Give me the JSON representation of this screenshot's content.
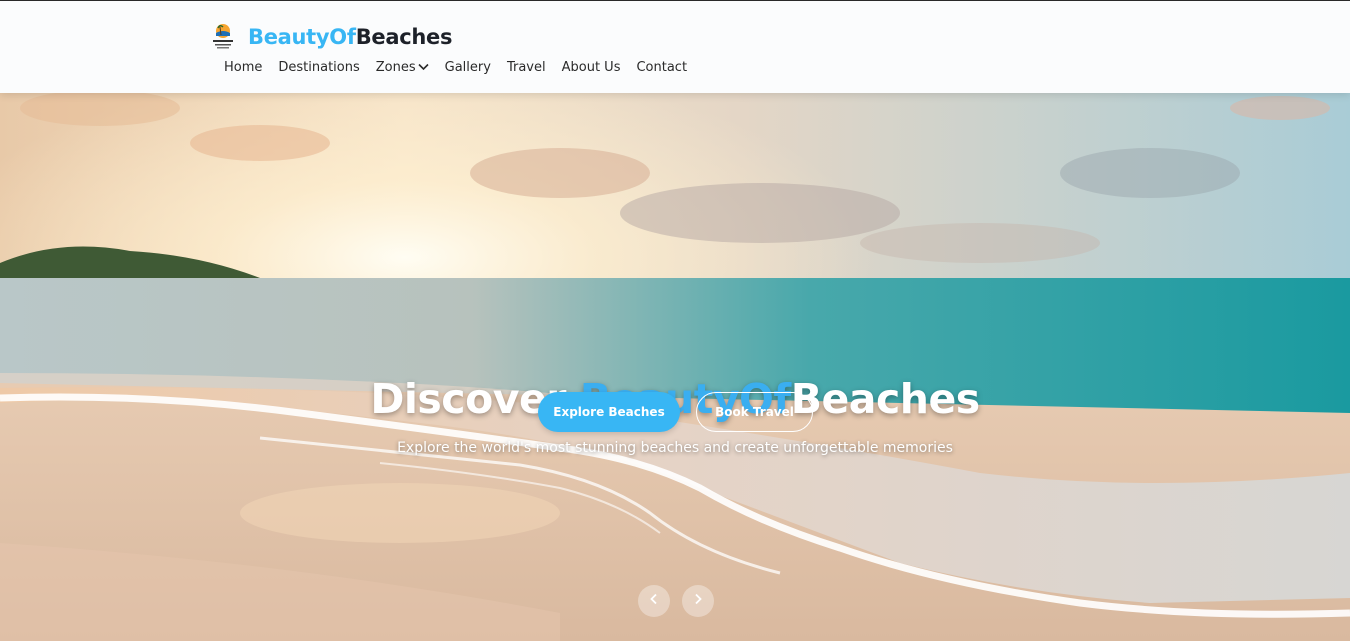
{
  "brand": {
    "name_part1": "BeautyOf",
    "name_part2": "Beaches",
    "logo_text": "BEAUTY OF BEACHES"
  },
  "nav": {
    "items": [
      {
        "label": "Home"
      },
      {
        "label": "Destinations"
      },
      {
        "label": "Zones",
        "has_dropdown": true
      },
      {
        "label": "Gallery"
      },
      {
        "label": "Travel"
      },
      {
        "label": "About Us"
      },
      {
        "label": "Contact"
      }
    ]
  },
  "hero": {
    "title_prefix": "Discover ",
    "title_accent": "BeautyOf",
    "title_suffix": "Beaches",
    "subtitle": "Explore the world's most stunning beaches and create unforgettable memories",
    "primary_button": "Explore Beaches",
    "secondary_button": "Book Travel",
    "prev_icon": "chevron-left-icon",
    "next_icon": "chevron-right-icon"
  },
  "colors": {
    "accent": "#38b6f4",
    "brand_dark": "#1d2129"
  }
}
